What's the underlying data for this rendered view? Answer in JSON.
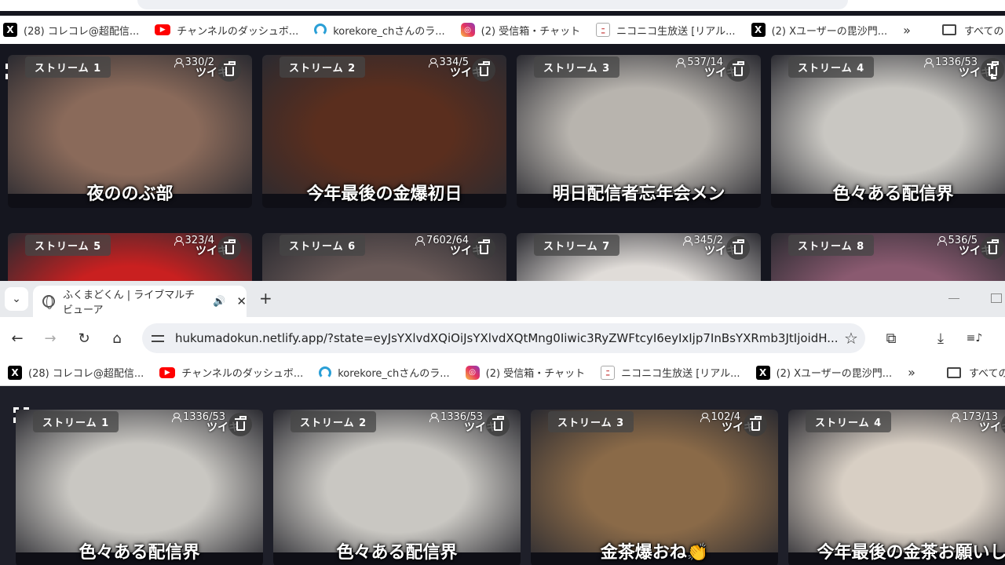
{
  "bookmarks": [
    {
      "icon": "x-icon",
      "label": "(28) コレコレ@超配信..."
    },
    {
      "icon": "youtube-icon",
      "label": "チャンネルのダッシュボ..."
    },
    {
      "icon": "korekore-icon",
      "label": "korekore_chさんのラ..."
    },
    {
      "icon": "instagram-icon",
      "label": "(2) 受信箱・チャット"
    },
    {
      "icon": "niconico-icon",
      "label": "ニコニコ生放送 [リアル..."
    },
    {
      "icon": "x-icon",
      "label": "(2) Xユーザーの毘沙門..."
    }
  ],
  "bookmarks_more": "»",
  "all_bookmarks_label": "すべてのブック",
  "all_bookmarks_label_front": "すべての",
  "back_tiles": [
    {
      "label": "ストリーム 1",
      "viewers": "330/2",
      "caption": "夜ののぶ部",
      "bg": "#8a6a5a"
    },
    {
      "label": "ストリーム 2",
      "viewers": "334/5",
      "caption": "今年最後の金爆初日",
      "bg": "#5a2e1e"
    },
    {
      "label": "ストリーム 3",
      "viewers": "537/14",
      "caption": "明日配信者忘年会メン",
      "bg": "#b8b4ae"
    },
    {
      "label": "ストリーム 4",
      "viewers": "1336/53",
      "caption": "色々ある配信界",
      "bg": "#c9c7c2"
    },
    {
      "label": "ストリーム 5",
      "viewers": "323/4",
      "caption": "",
      "bg": "#c92020"
    },
    {
      "label": "ストリーム 6",
      "viewers": "7602/64",
      "caption": "",
      "bg": "#6a5a58"
    },
    {
      "label": "ストリーム 7",
      "viewers": "345/2",
      "caption": "",
      "bg": "#e0dcd8"
    },
    {
      "label": "ストリーム 8",
      "viewers": "536/5",
      "caption": "",
      "bg": "#8a5a70"
    }
  ],
  "front_tab": {
    "title": "ふくまどくん | ライブマルチビューア"
  },
  "address_url": "hukumadokun.netlify.app/?state=eyJsYXlvdXQiOiJsYXlvdXQtMng0Iiwic3RyZWFtcyI6eyIxIjp7InBsYXRmb3JtIjoidH...",
  "tsuiki_label": "ツイキ",
  "front_tiles": [
    {
      "label": "ストリーム 1",
      "viewers": "1336/53",
      "caption": "色々ある配信界",
      "bg": "#c9c7c2"
    },
    {
      "label": "ストリーム 2",
      "viewers": "1336/53",
      "caption": "色々ある配信界",
      "bg": "#c9c7c2"
    },
    {
      "label": "ストリーム 3",
      "viewers": "102/4",
      "caption": "金茶爆おね👏",
      "bg": "#8a6a48"
    },
    {
      "label": "ストリーム 4",
      "viewers": "173/13",
      "caption": "今年最後の金茶お願いし",
      "bg": "#d8cfc4"
    }
  ],
  "icons": {
    "new_tab": "+",
    "close": "✕",
    "back": "←",
    "forward": "→",
    "reload": "↻",
    "home": "⌂",
    "star": "☆",
    "download": "⤓",
    "extensions": "⧉",
    "tab_list": "⌄",
    "speaker": "🔊"
  }
}
